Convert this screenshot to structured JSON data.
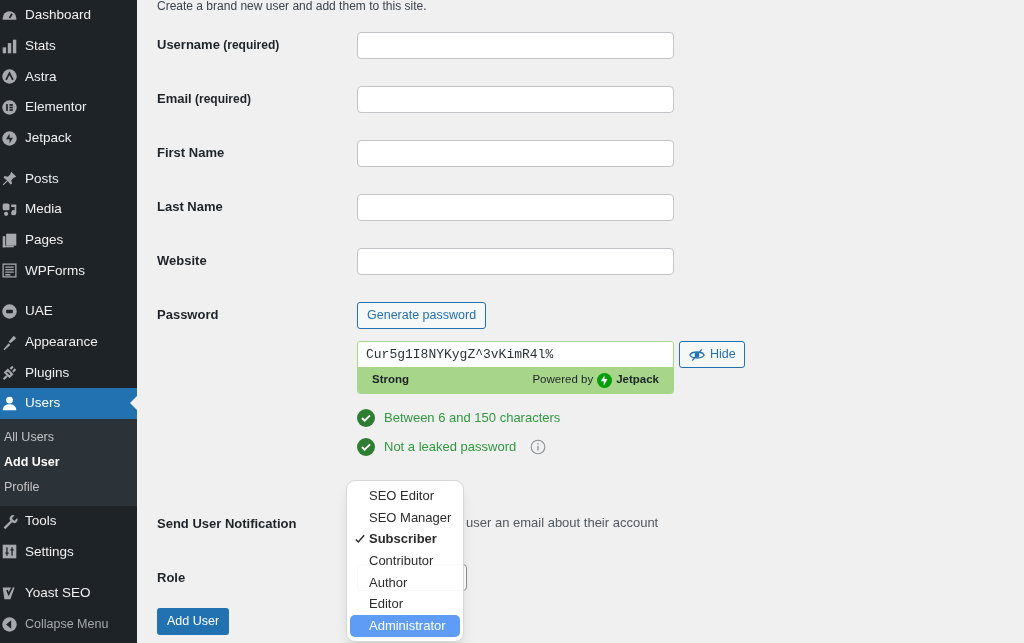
{
  "sidebar": {
    "groups": [
      {
        "items": [
          {
            "label": "Dashboard",
            "selected": false
          },
          {
            "label": "Stats",
            "selected": false
          },
          {
            "label": "Astra",
            "selected": false
          },
          {
            "label": "Elementor",
            "selected": false
          },
          {
            "label": "Jetpack",
            "selected": false
          }
        ]
      },
      {
        "items": [
          {
            "label": "Posts",
            "selected": false
          },
          {
            "label": "Media",
            "selected": false
          },
          {
            "label": "Pages",
            "selected": false
          },
          {
            "label": "WPForms",
            "selected": false
          }
        ]
      },
      {
        "items": [
          {
            "label": "UAE",
            "selected": false
          },
          {
            "label": "Appearance",
            "selected": false
          },
          {
            "label": "Plugins",
            "selected": false
          },
          {
            "label": "Users",
            "selected": true,
            "children": [
              {
                "label": "All Users",
                "selected": false
              },
              {
                "label": "Add User",
                "selected": true
              },
              {
                "label": "Profile",
                "selected": false
              }
            ]
          },
          {
            "label": "Tools",
            "selected": false
          },
          {
            "label": "Settings",
            "selected": false
          }
        ]
      },
      {
        "items": [
          {
            "label": "Yoast SEO",
            "selected": false
          }
        ]
      }
    ],
    "collapse": "Collapse Menu"
  },
  "form": {
    "intro": "Create a brand new user and add them to this site.",
    "fields": [
      {
        "label": "Username",
        "note": "(required)"
      },
      {
        "label": "Email",
        "note": "(required)"
      },
      {
        "label": "First Name"
      },
      {
        "label": "Last Name"
      },
      {
        "label": "Website"
      }
    ],
    "password": {
      "label": "Password",
      "generate_button": "Generate password",
      "value": "Cur5g1I8NYKygZ^3vKimR4l%",
      "strength": "Strong",
      "powered_by": "Powered by",
      "brand": "Jetpack",
      "hide_button": "Hide",
      "checks": [
        {
          "text": "Between 6 and 150 characters",
          "passed": true,
          "info": false
        },
        {
          "text": "Not a leaked password",
          "passed": true,
          "info": true
        }
      ]
    },
    "notification": {
      "label": "Send User Notification",
      "text": "user an email about their account"
    },
    "role": {
      "label": "Role",
      "options": [
        {
          "label": "SEO Editor",
          "selected": false,
          "highlighted": false
        },
        {
          "label": "SEO Manager",
          "selected": false,
          "highlighted": false
        },
        {
          "label": "Subscriber",
          "selected": true,
          "highlighted": false
        },
        {
          "label": "Contributor",
          "selected": false,
          "highlighted": false
        },
        {
          "label": "Author",
          "selected": false,
          "highlighted": false
        },
        {
          "label": "Editor",
          "selected": false,
          "highlighted": false
        },
        {
          "label": "Administrator",
          "selected": false,
          "highlighted": true
        }
      ]
    },
    "submit": "Add User"
  }
}
